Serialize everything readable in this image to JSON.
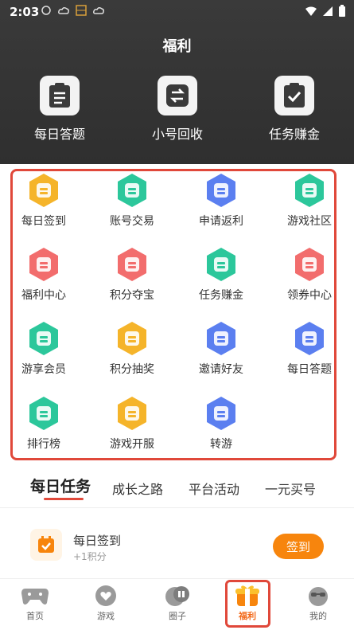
{
  "status": {
    "time": "2:03"
  },
  "header": {
    "title": "福利",
    "quick": [
      {
        "label": "每日答题",
        "icon": "quiz-icon"
      },
      {
        "label": "小号回收",
        "icon": "exchange-icon"
      },
      {
        "label": "任务赚金",
        "icon": "task-check-icon"
      }
    ]
  },
  "grid": [
    {
      "label": "每日签到",
      "icon": "sign-in-icon",
      "color": "#f5b42a"
    },
    {
      "label": "账号交易",
      "icon": "trade-icon",
      "color": "#2cc79b"
    },
    {
      "label": "申请返利",
      "icon": "rebate-icon",
      "color": "#5b7ff0"
    },
    {
      "label": "游戏社区",
      "icon": "community-icon",
      "color": "#2cc79b"
    },
    {
      "label": "福利中心",
      "icon": "welfare-icon",
      "color": "#f26d6d"
    },
    {
      "label": "积分夺宝",
      "icon": "treasure-icon",
      "color": "#f26d6d"
    },
    {
      "label": "任务赚金",
      "icon": "task-icon",
      "color": "#2cc79b"
    },
    {
      "label": "领券中心",
      "icon": "coupon-icon",
      "color": "#f26d6d"
    },
    {
      "label": "游享会员",
      "icon": "vip-icon",
      "color": "#2cc79b"
    },
    {
      "label": "积分抽奖",
      "icon": "lottery-icon",
      "color": "#f5b42a"
    },
    {
      "label": "邀请好友",
      "icon": "invite-icon",
      "color": "#5b7ff0"
    },
    {
      "label": "每日答题",
      "icon": "daily-quiz-icon",
      "color": "#5b7ff0"
    },
    {
      "label": "排行榜",
      "icon": "ranking-icon",
      "color": "#2cc79b"
    },
    {
      "label": "游戏开服",
      "icon": "server-open-icon",
      "color": "#f5b42a"
    },
    {
      "label": "转游",
      "icon": "transfer-icon",
      "color": "#5b7ff0"
    }
  ],
  "tabs": [
    {
      "label": "每日任务"
    },
    {
      "label": "成长之路"
    },
    {
      "label": "平台活动"
    },
    {
      "label": "一元买号"
    }
  ],
  "task": {
    "name": "每日签到",
    "sub": "+1积分",
    "button": "签到"
  },
  "nav": [
    {
      "label": "首页",
      "icon": "home-gamepad-icon"
    },
    {
      "label": "游戏",
      "icon": "game-heart-icon"
    },
    {
      "label": "圈子",
      "icon": "circle-chat-icon"
    },
    {
      "label": "福利",
      "icon": "gift-icon"
    },
    {
      "label": "我的",
      "icon": "profile-icon"
    }
  ],
  "colors": {
    "accent": "#f7850d",
    "highlight": "#e0483a"
  }
}
